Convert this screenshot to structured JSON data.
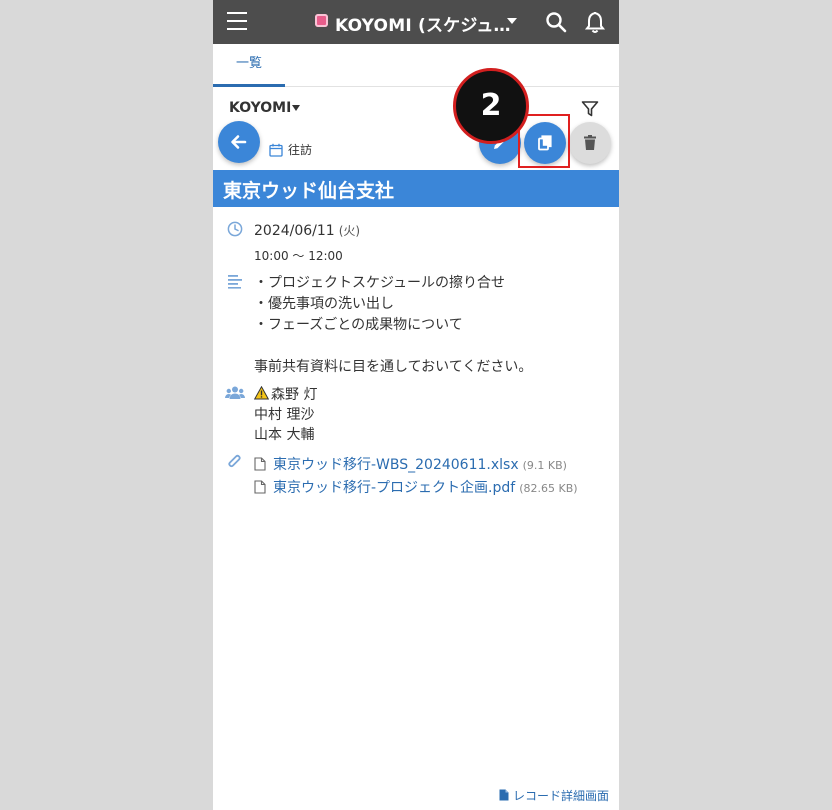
{
  "header": {
    "app_title": "KOYOMI (スケジュ…",
    "icons": [
      "menu-icon",
      "app-logo-icon",
      "chevron-down-icon",
      "search-icon",
      "bell-icon"
    ]
  },
  "tabs": [
    {
      "label": "一覧",
      "active": true
    }
  ],
  "app_selector": {
    "label": "KOYOMI"
  },
  "step_badge": {
    "number": "2"
  },
  "record": {
    "category": "往訪",
    "title": "東京ウッド仙台支社",
    "date": "2024/06/11",
    "weekday": "(火)",
    "time": "10:00 ～ 12:00",
    "memo_lines": [
      "・プロジェクトスケジュールの擦り合せ",
      "・優先事項の洗い出し",
      "・フェーズごとの成果物について",
      "",
      "事前共有資料に目を通しておいてください。"
    ],
    "attendees": [
      "森野 灯",
      "中村 理沙",
      "山本 大輔"
    ],
    "attachments": [
      {
        "name": "東京ウッド移行-WBS_20240611.xlsx",
        "size": "(9.1 KB)"
      },
      {
        "name": "東京ウッド移行-プロジェクト企画.pdf",
        "size": "(82.65 KB)"
      }
    ]
  },
  "footer": {
    "detail_link": "レコード詳細画面"
  },
  "colors": {
    "header_bg": "#4d4d4d",
    "accent": "#3b86d8",
    "link": "#2b6cb0",
    "highlight": "#e02020",
    "page_bg": "#d9d9d9"
  }
}
